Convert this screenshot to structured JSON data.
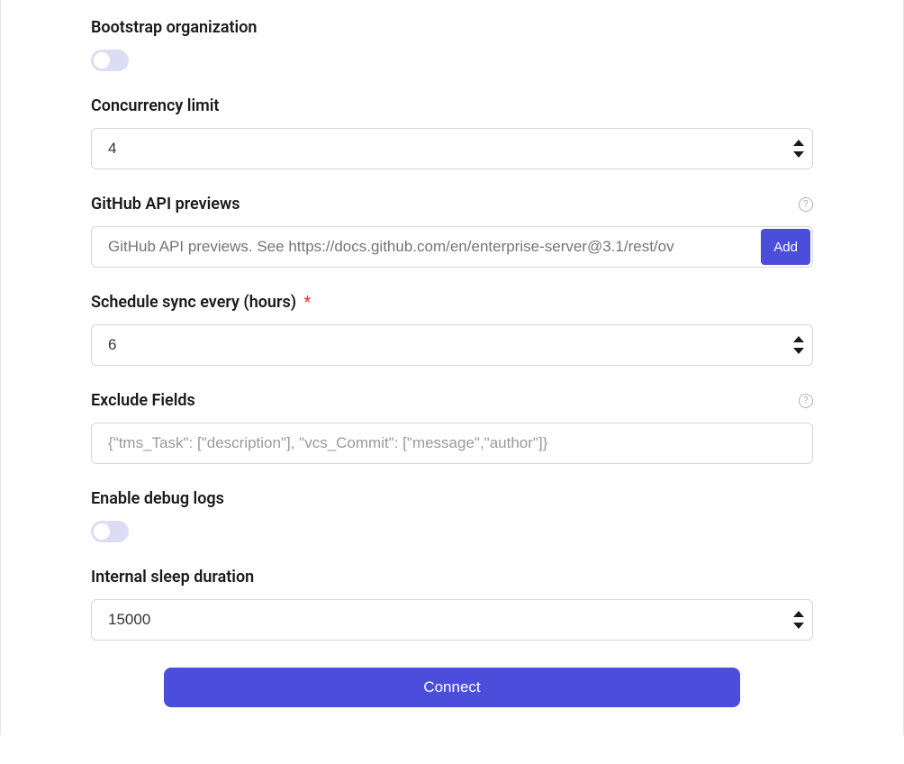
{
  "bootstrap": {
    "label": "Bootstrap organization",
    "value": false
  },
  "concurrency": {
    "label": "Concurrency limit",
    "value": "4"
  },
  "previews": {
    "label": "GitHub API previews",
    "placeholder": "GitHub API previews. See https://docs.github.com/en/enterprise-server@3.1/rest/ov",
    "add_label": "Add"
  },
  "schedule": {
    "label": "Schedule sync every (hours)",
    "required": true,
    "value": "6"
  },
  "exclude": {
    "label": "Exclude Fields",
    "placeholder": "{\"tms_Task\": [\"description\"], \"vcs_Commit\": [\"message\",\"author\"]}"
  },
  "debug": {
    "label": "Enable debug logs",
    "value": false
  },
  "sleep": {
    "label": "Internal sleep duration",
    "value": "15000"
  },
  "connect_label": "Connect",
  "required_marker": "*"
}
